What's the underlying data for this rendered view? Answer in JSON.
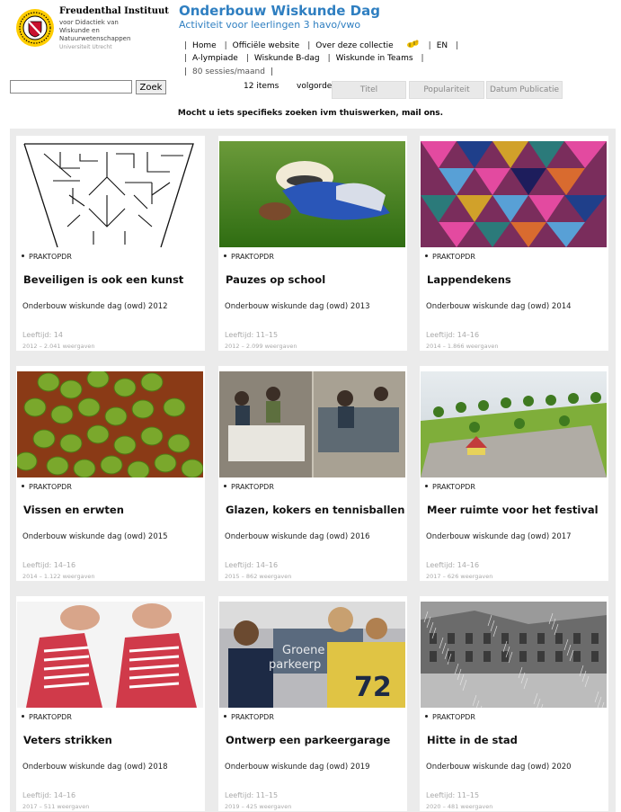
{
  "institute": {
    "name": "Freudenthal Instituut",
    "subtitle_lines": [
      "voor Didactiek van",
      "Wiskunde en",
      "Natuurwetenschappen"
    ],
    "university": "Universiteit Utrecht"
  },
  "site": {
    "title": "Onderbouw Wiskunde Dag",
    "subtitle": "Activiteit voor leerlingen 3 havo/vwo"
  },
  "nav": {
    "row1": [
      "Home",
      "Officiële website",
      "Over deze collectie"
    ],
    "lang": "EN",
    "row2": [
      "A-lympiade",
      "Wiskunde B-dag",
      "Wiskunde in Teams"
    ],
    "stats": "80 sessies/maand"
  },
  "search": {
    "value": "",
    "button": "Zoek",
    "items_count": "12 items",
    "order_label": "volgorde",
    "sort_options": [
      "Titel",
      "Populariteit",
      "Datum Publicatie"
    ]
  },
  "notice": {
    "text": "Mocht u iets specifieks zoeken ivm thuiswerken, ",
    "link": "mail ons",
    "end": "."
  },
  "cards": [
    {
      "tag": "PRAKTOPDR",
      "title": "Beveiligen is ook een kunst",
      "series": "Onderbouw wiskunde dag (owd) 2012",
      "age": "Leeftijd: 14",
      "meta": "2012 – 2.041 weergaven",
      "image": "maze"
    },
    {
      "tag": "PRAKTOPDR",
      "title": "Pauzes op school",
      "series": "Onderbouw wiskunde dag (owd) 2013",
      "age": "Leeftijd: 11–15",
      "meta": "2012 – 2.099 weergaven",
      "image": "grass"
    },
    {
      "tag": "PRAKTOPDR",
      "title": "Lappendekens",
      "series": "Onderbouw wiskunde dag (owd) 2014",
      "age": "Leeftijd: 14–16",
      "meta": "2014 – 1.866 weergaven",
      "image": "quilt"
    },
    {
      "tag": "PRAKTOPDR",
      "title": "Vissen en erwten",
      "series": "Onderbouw wiskunde dag (owd) 2015",
      "age": "Leeftijd: 14–16",
      "meta": "2014 – 1.122 weergaven",
      "image": "peas"
    },
    {
      "tag": "PRAKTOPDR",
      "title": "Glazen, kokers en tennisballen",
      "series": "Onderbouw wiskunde dag (owd) 2016",
      "age": "Leeftijd: 14–16",
      "meta": "2015 – 862 weergaven",
      "image": "classroom"
    },
    {
      "tag": "PRAKTOPDR",
      "title": "Meer ruimte voor het festival",
      "series": "Onderbouw wiskunde dag (owd) 2017",
      "age": "Leeftijd: 14–16",
      "meta": "2017 – 626 weergaven",
      "image": "festival"
    },
    {
      "tag": "PRAKTOPDR",
      "title": "Veters strikken",
      "series": "Onderbouw wiskunde dag (owd) 2018",
      "age": "Leeftijd: 14–16",
      "meta": "2017 – 511 weergaven",
      "image": "shoes"
    },
    {
      "tag": "PRAKTOPDR",
      "title": "Ontwerp een parkeergarage",
      "series": "Onderbouw wiskunde dag (owd) 2019",
      "age": "Leeftijd: 11–15",
      "meta": "2019 – 425 weergaven",
      "image": "students"
    },
    {
      "tag": "PRAKTOPDR",
      "title": "Hitte in de stad",
      "series": "Onderbouw wiskunde dag (owd) 2020",
      "age": "Leeftijd: 11–15",
      "meta": "2020 – 481 weergaven",
      "image": "rain"
    }
  ],
  "image_overlay_text": [
    "Groene",
    "parkeerp"
  ]
}
